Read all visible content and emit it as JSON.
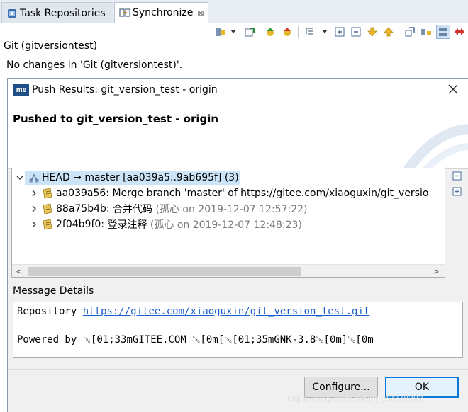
{
  "tabs": [
    {
      "label": "Task Repositories",
      "active": false
    },
    {
      "label": "Synchronize",
      "active": true,
      "close": "⊠"
    }
  ],
  "view": {
    "title": "Git (gitversiontest)",
    "message": "No changes in 'Git (gitversiontest)'."
  },
  "dialog": {
    "app_logo": "me",
    "title": "Push Results: git_version_test - origin",
    "header": "Pushed to git_version_test - origin",
    "tree": {
      "root": {
        "label": "HEAD → master [aa039a5..9ab695f] (3)",
        "expanded": true,
        "icon": "repo-push-icon"
      },
      "commits": [
        {
          "id": "aa039a56:",
          "message": "Merge branch 'master' of https://gitee.com/xiaoguxin/git_versio",
          "meta": "",
          "icon": "commit-icon"
        },
        {
          "id": "88a75b4b:",
          "message": "合并代码",
          "meta": "(孤心 on 2019-12-07 12:57:22)",
          "icon": "commit-icon"
        },
        {
          "id": "2f04b9f0:",
          "message": "登录注释",
          "meta": "(孤心 on 2019-12-07 12:48:23)",
          "icon": "commit-icon"
        }
      ],
      "scroll_left": "<",
      "scroll_right": ">"
    },
    "message_details": {
      "label": "Message Details",
      "repo_prefix": "Repository",
      "repo_url": "https://gitee.com/xiaoguxin/git_version_test.git",
      "powered_line": "Powered by ␛[01;33mGITEE.COM ␛[0m[␛[01;35mGNK-3.8␛[0m]␛[0m"
    },
    "buttons": {
      "configure": "Configure...",
      "ok": "OK"
    }
  },
  "watermark": "https://blog.csdn.net/qq_42278202",
  "colors": {
    "selection": "#cce4f7",
    "link": "#1a5ec9",
    "default_button_border": "#0a78d7"
  }
}
